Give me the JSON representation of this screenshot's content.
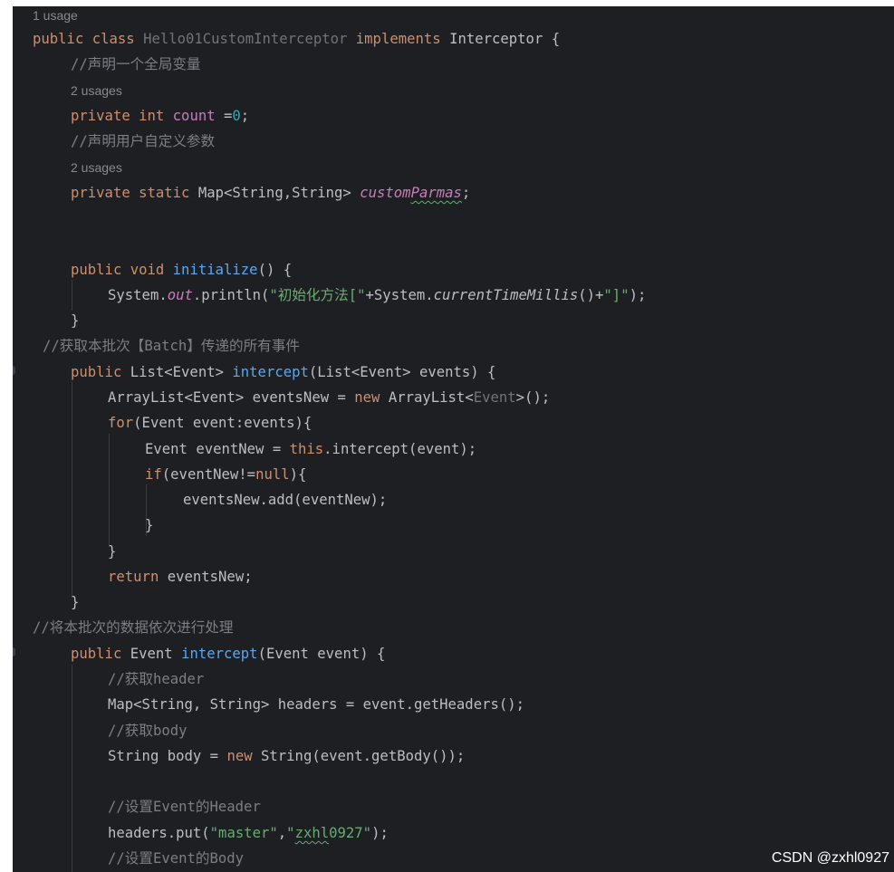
{
  "editor": {
    "usage_1": "1 usage",
    "line_class_decl": "public class Hello01CustomInterceptor implements Interceptor {",
    "comment_global": "//声明一个全局变量",
    "usage_2a": "2 usages",
    "line_count": "private int count =0;",
    "comment_custom_params": "//声明用户自定义参数",
    "usage_2b": "2 usages",
    "line_map_field": "private static Map<String,String> customParmas;",
    "line_initialize": "public void initialize() {",
    "line_println": "System.out.println(\"初始化方法[\"+System.currentTimeMillis()+\"]\");",
    "line_brace": "}",
    "comment_batch": "//获取本批次【Batch】传递的所有事件",
    "line_intercept_list": "public List<Event> intercept(List<Event> events) {",
    "line_arraylist": "ArrayList<Event> eventsNew = new ArrayList<Event>();",
    "line_for": "for(Event event:events){",
    "line_eventnew": "Event eventNew = this.intercept(event);",
    "line_if": "if(eventNew!=null){",
    "line_add": "eventsNew.add(eventNew);",
    "line_return": "return eventsNew;",
    "comment_process": "//将本批次的数据依次进行处理",
    "line_intercept_event": "public Event intercept(Event event) {",
    "comment_header": "//获取header",
    "line_headers": "Map<String, String> headers = event.getHeaders();",
    "comment_body": "//获取body",
    "line_body": "String body = new String(event.getBody());",
    "comment_set_header": "//设置Event的Header",
    "line_put": "headers.put(\"master\",\"zxhl0927\");",
    "comment_set_body": "//设置Event的Body"
  },
  "watermark": "CSDN @zxhl0927",
  "colors": {
    "background": "#1e1f22",
    "keyword": "#cf8e6d",
    "method": "#56a8f5",
    "field": "#c77dbb",
    "number": "#2aacb8",
    "string": "#6aab73",
    "comment": "#7a7e85",
    "text": "#bcbec4"
  }
}
